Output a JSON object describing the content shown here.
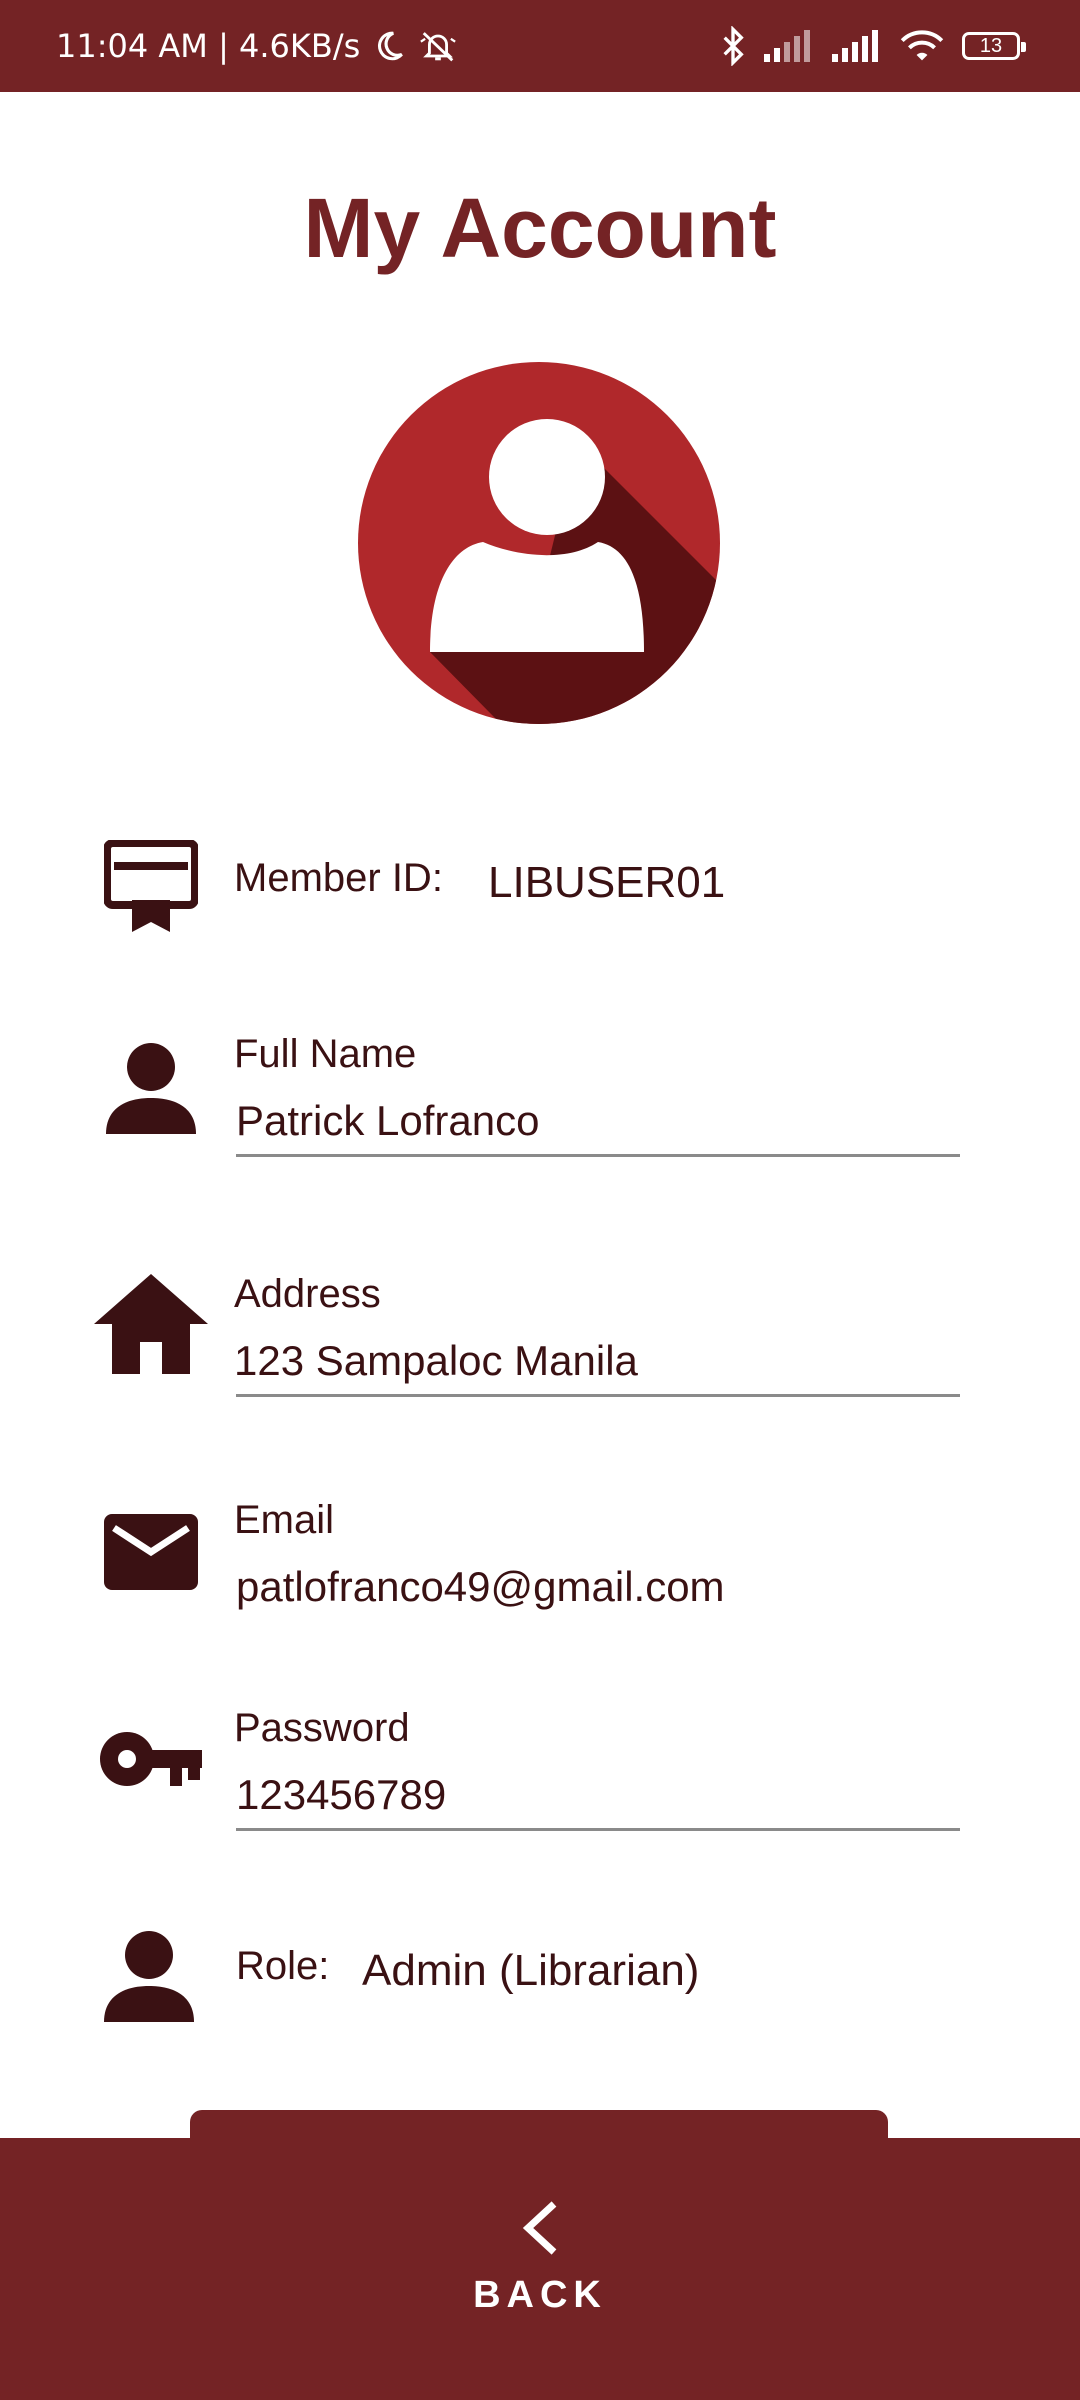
{
  "status_bar": {
    "time_speed": "11:04 AM | 4.6KB/s",
    "battery": "13",
    "icons": [
      "moon-icon",
      "bell-off-icon",
      "bluetooth-icon",
      "signal-icon",
      "signal-icon",
      "wifi-icon",
      "battery-icon"
    ]
  },
  "header": {
    "title": "My Account"
  },
  "account": {
    "member_id_label": "Member ID:",
    "member_id": "LIBUSER01",
    "full_name_label": "Full Name",
    "full_name": "Patrick Lofranco",
    "address_label": "Address",
    "address": "123 Sampaloc Manila",
    "email_label": "Email",
    "email": "patlofranco49@gmail.com",
    "password_label": "Password",
    "password": "123456789",
    "role_label": "Role:",
    "role": "Admin (Librarian)"
  },
  "footer": {
    "back_label": "BACK"
  },
  "colors": {
    "primary": "#742325",
    "avatar_red": "#B0282B",
    "text": "#3A1113"
  }
}
